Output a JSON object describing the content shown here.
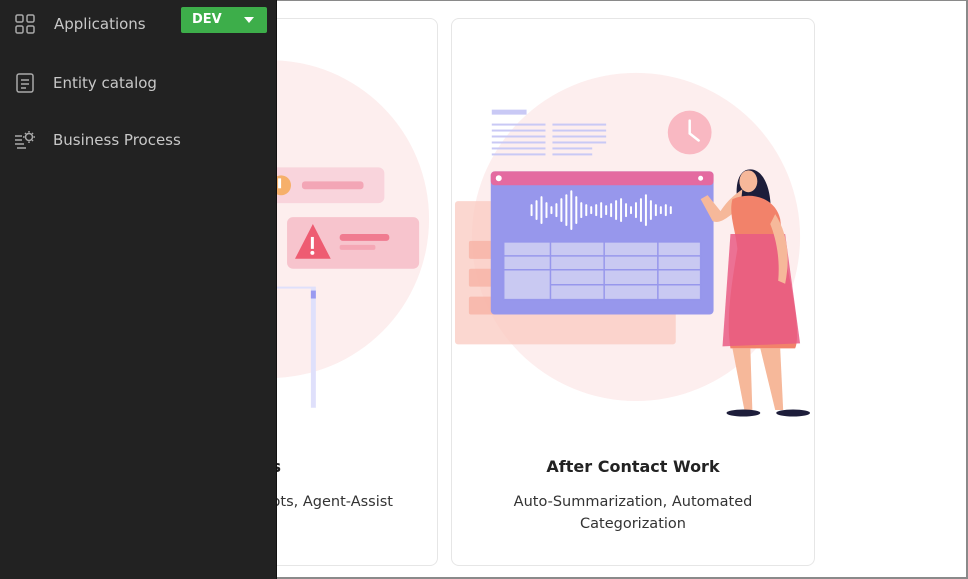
{
  "sidebar": {
    "items": [
      {
        "label": "Applications",
        "icon": "grid-icon"
      },
      {
        "label": "Entity catalog",
        "icon": "document-icon"
      },
      {
        "label": "Business Process",
        "icon": "process-gear-icon"
      }
    ],
    "env_selector": {
      "label": "DEV",
      "icon": "caret-down-icon"
    }
  },
  "cards": [
    {
      "title": "s",
      "description": "ots, Agent-Assist"
    },
    {
      "title": "After Contact Work",
      "description": "Auto-Summarization, Automated Categorization"
    }
  ],
  "colors": {
    "sidebar_bg": "#222222",
    "env_green": "#3dae4a",
    "illustration_pink": "#fdeaea",
    "illustration_purple": "#8e8ee8"
  }
}
